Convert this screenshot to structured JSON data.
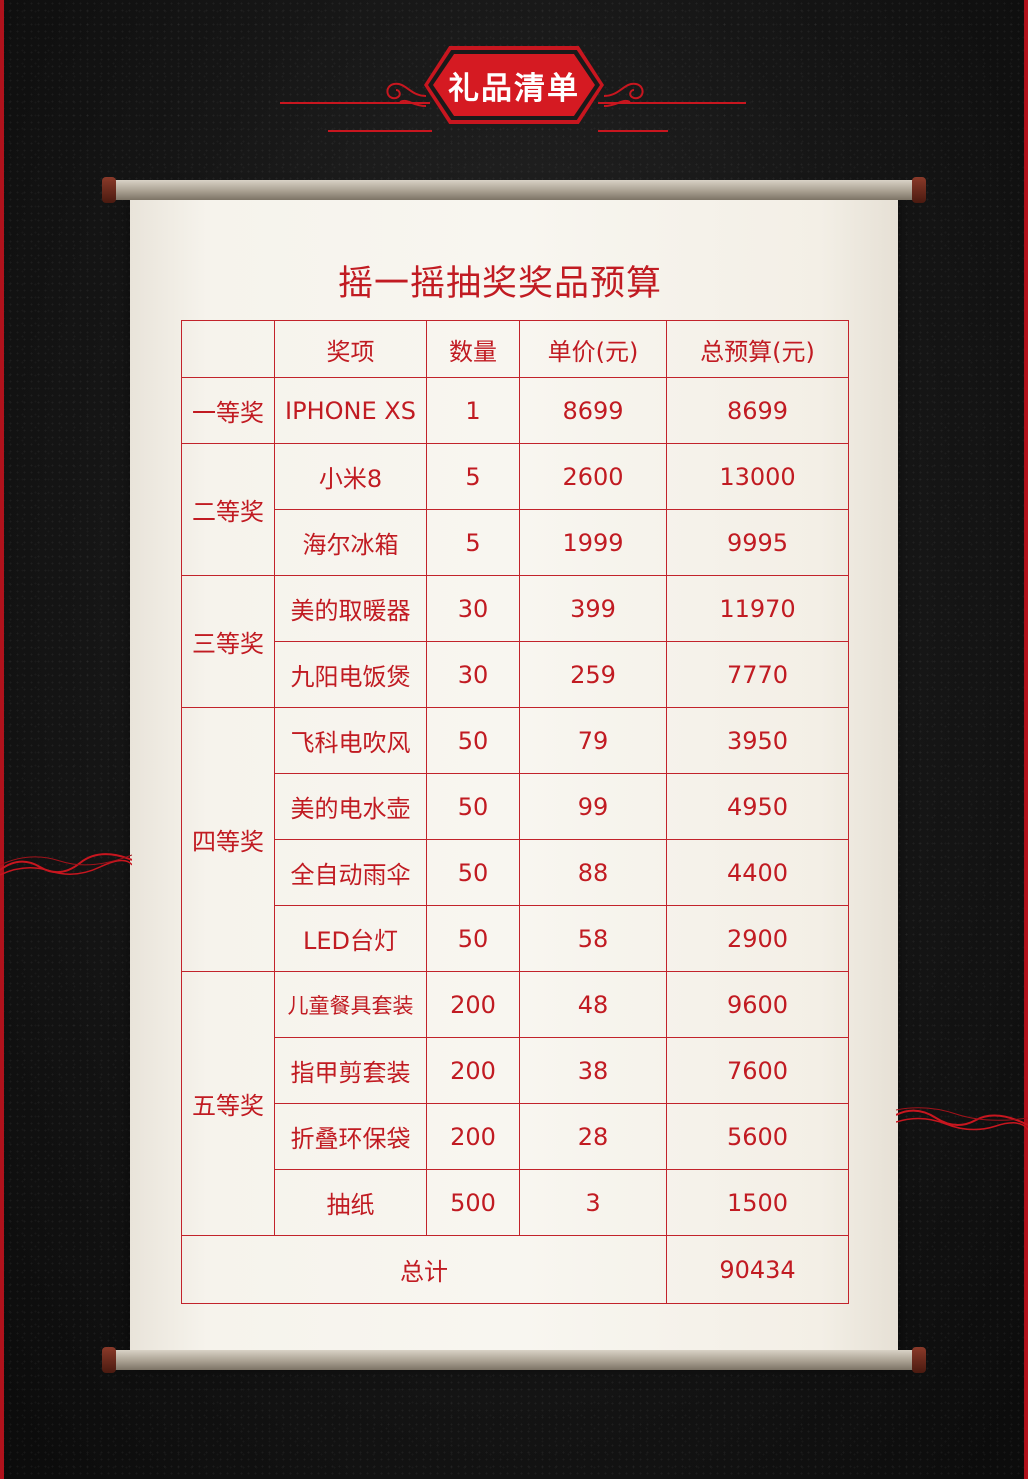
{
  "header": {
    "badge_title": "礼品清单"
  },
  "document": {
    "title": "摇一摇抽奖奖品预算"
  },
  "table": {
    "headers": [
      "",
      "奖项",
      "数量",
      "单价(元)",
      "总预算(元)"
    ],
    "groups": [
      {
        "tier": "一等奖",
        "items": [
          {
            "name": "IPHONE XS",
            "qty": "1",
            "unit_price": "8699",
            "total": "8699"
          }
        ]
      },
      {
        "tier": "二等奖",
        "items": [
          {
            "name": "小米8",
            "qty": "5",
            "unit_price": "2600",
            "total": "13000"
          },
          {
            "name": "海尔冰箱",
            "qty": "5",
            "unit_price": "1999",
            "total": "9995"
          }
        ]
      },
      {
        "tier": "三等奖",
        "items": [
          {
            "name": "美的取暖器",
            "qty": "30",
            "unit_price": "399",
            "total": "11970"
          },
          {
            "name": "九阳电饭煲",
            "qty": "30",
            "unit_price": "259",
            "total": "7770"
          }
        ]
      },
      {
        "tier": "四等奖",
        "items": [
          {
            "name": "飞科电吹风",
            "qty": "50",
            "unit_price": "79",
            "total": "3950"
          },
          {
            "name": "美的电水壶",
            "qty": "50",
            "unit_price": "99",
            "total": "4950"
          },
          {
            "name": "全自动雨伞",
            "qty": "50",
            "unit_price": "88",
            "total": "4400"
          },
          {
            "name": "LED台灯",
            "qty": "50",
            "unit_price": "58",
            "total": "2900"
          }
        ]
      },
      {
        "tier": "五等奖",
        "items": [
          {
            "name": "儿童餐具套装",
            "qty": "200",
            "unit_price": "48",
            "total": "9600"
          },
          {
            "name": "指甲剪套装",
            "qty": "200",
            "unit_price": "38",
            "total": "7600"
          },
          {
            "name": "折叠环保袋",
            "qty": "200",
            "unit_price": "28",
            "total": "5600"
          },
          {
            "name": "抽纸",
            "qty": "500",
            "unit_price": "3",
            "total": "1500"
          }
        ]
      }
    ],
    "footer": {
      "label": "总计",
      "total": "90434"
    }
  },
  "colors": {
    "accent": "#c11b22",
    "background": "#161616",
    "paper": "#f6f3ec"
  }
}
